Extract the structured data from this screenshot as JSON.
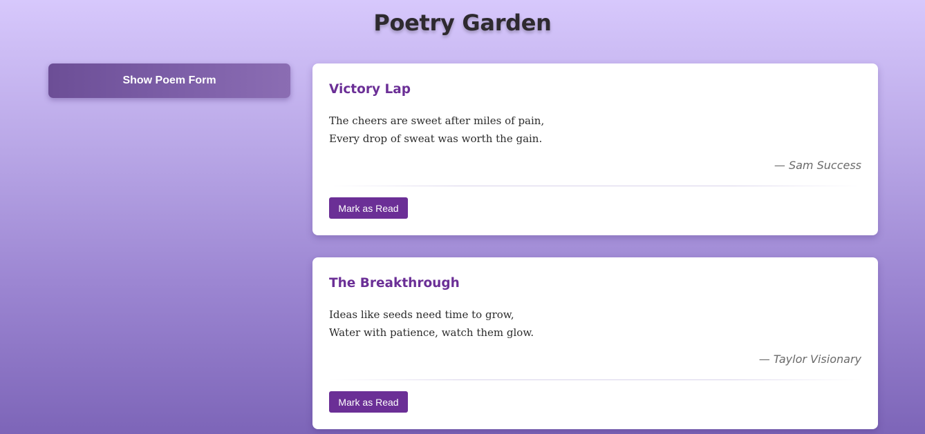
{
  "page": {
    "title": "Poetry Garden"
  },
  "sidebar": {
    "show_form_label": "Show Poem Form"
  },
  "poems": [
    {
      "title": "Victory Lap",
      "lines": [
        "The cheers are sweet after miles of pain,",
        "Every drop of sweat was worth the gain."
      ],
      "author": "— Sam Success",
      "action_label": "Mark as Read"
    },
    {
      "title": "The Breakthrough",
      "lines": [
        "Ideas like seeds need time to grow,",
        "Water with patience, watch them glow."
      ],
      "author": "— Taylor Visionary",
      "action_label": "Mark as Read"
    }
  ],
  "colors": {
    "accent": "#6b2f96",
    "button_gradient_start": "#6c4e96",
    "button_gradient_end": "#8b6db3",
    "background_top": "#d7c8fc",
    "background_bottom": "#7d65b8"
  }
}
